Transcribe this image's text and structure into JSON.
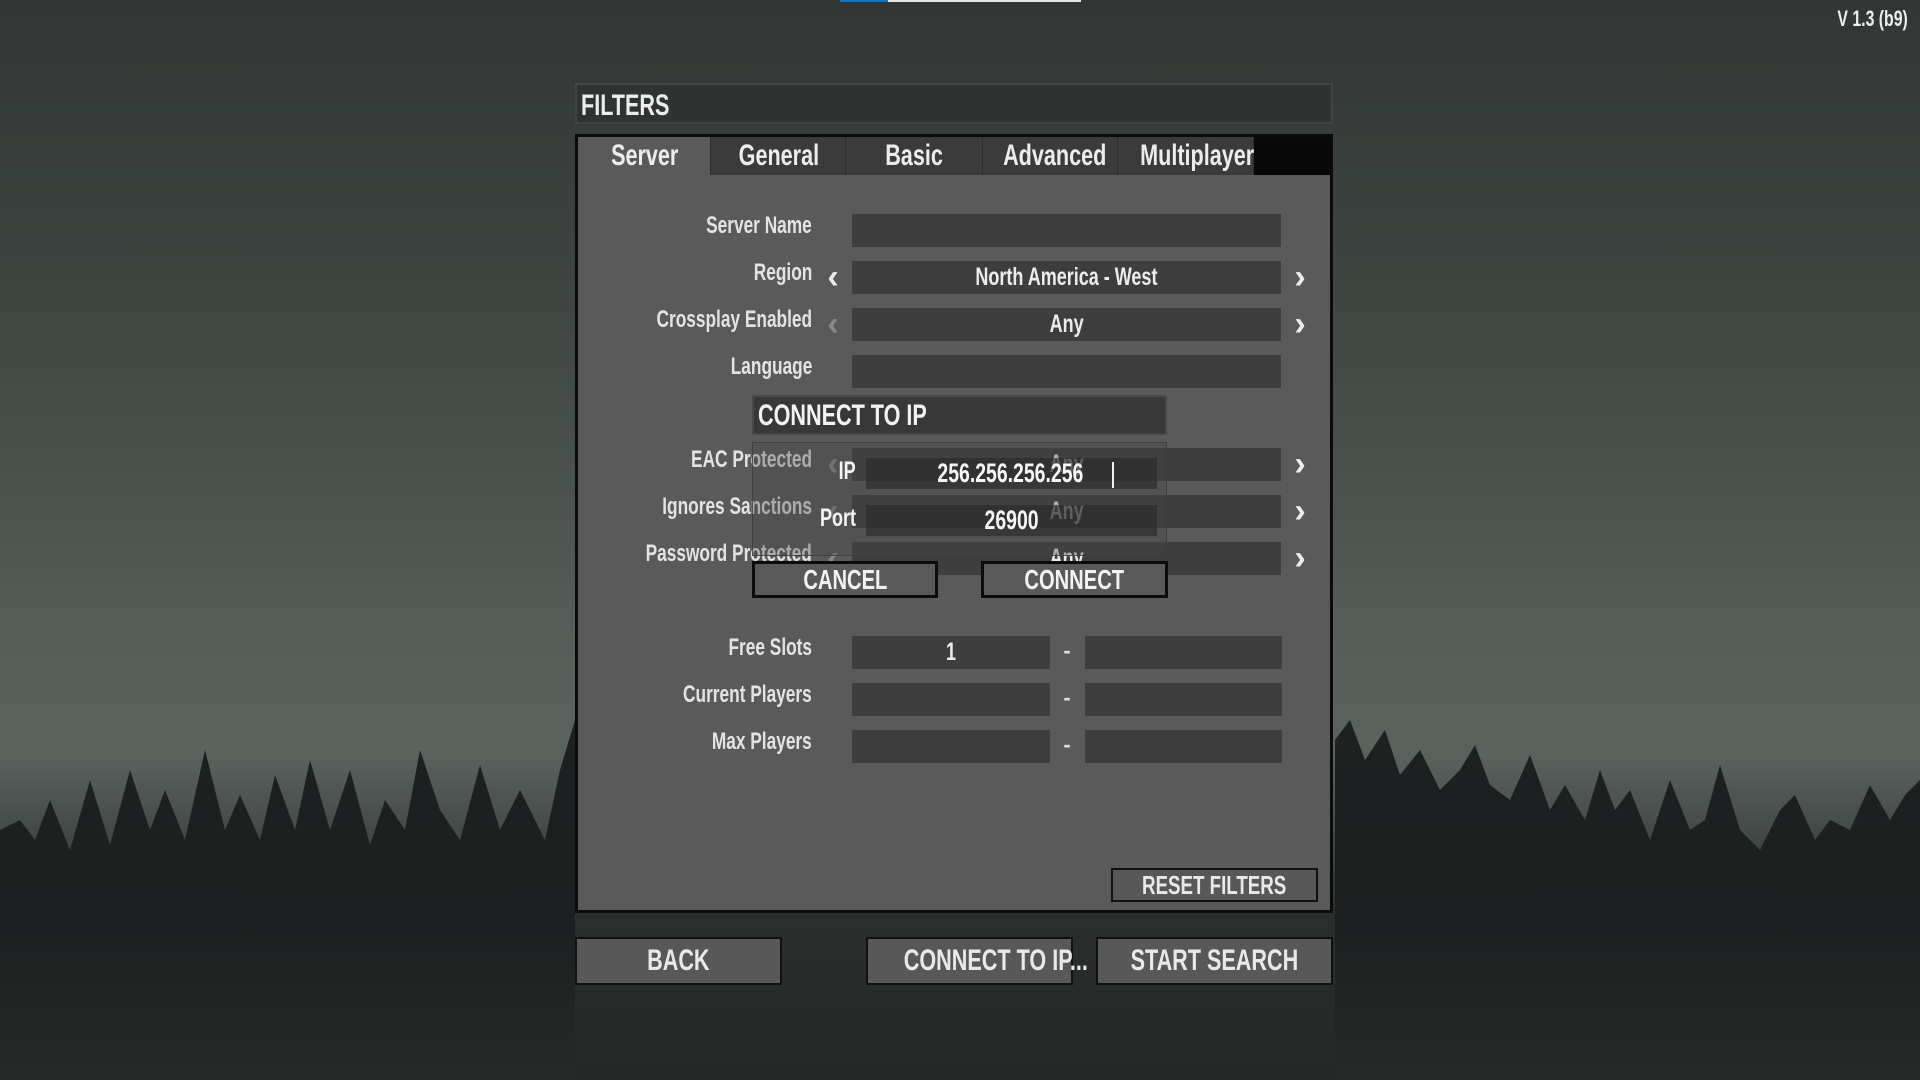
{
  "top_progress": {
    "fraction": 0.2,
    "fill_color": "#1f6fb5",
    "track_color": "#e6e6e6"
  },
  "version": "V 1.3 (b9)",
  "filters": {
    "title": "FILTERS",
    "tabs": [
      {
        "label": "Server",
        "active": true
      },
      {
        "label": "General",
        "active": false
      },
      {
        "label": "Basic",
        "active": false
      },
      {
        "label": "Advanced",
        "active": false
      },
      {
        "label": "Multiplayer",
        "active": false
      }
    ],
    "rows": {
      "server_name": {
        "label": "Server Name",
        "value": ""
      },
      "region": {
        "label": "Region",
        "value": "North America - West",
        "left_arrow": "chevron-left-icon",
        "right_arrow": "chevron-right-icon"
      },
      "crossplay": {
        "label": "Crossplay Enabled",
        "value": "Any",
        "left_arrow": "chevron-left-icon",
        "right_arrow": "chevron-right-icon"
      },
      "language": {
        "label": "Language",
        "value": ""
      },
      "eac": {
        "label": "EAC Protected",
        "value": "Any"
      },
      "sanctions": {
        "label": "Ignores Sanctions",
        "value": "Any"
      },
      "password": {
        "label": "Password Protected",
        "value": "Any"
      },
      "free_slots": {
        "label": "Free Slots",
        "min": "1",
        "max": "",
        "separator": "-"
      },
      "current_players": {
        "label": "Current Players",
        "min": "",
        "max": "",
        "separator": "-"
      },
      "max_players": {
        "label": "Max Players",
        "min": "",
        "max": "",
        "separator": "-"
      }
    },
    "reset_label": "RESET FILTERS"
  },
  "icons": {
    "left": "‹",
    "right": "›"
  },
  "bottom_buttons": {
    "back": "BACK",
    "connect_ip": "CONNECT TO IP...",
    "start_search": "START SEARCH"
  },
  "connect_dialog": {
    "title": "CONNECT TO IP",
    "ip_label": "IP",
    "ip_value": "256.256.256.256",
    "port_label": "Port",
    "port_value": "26900",
    "cancel": "CANCEL",
    "connect": "CONNECT"
  }
}
